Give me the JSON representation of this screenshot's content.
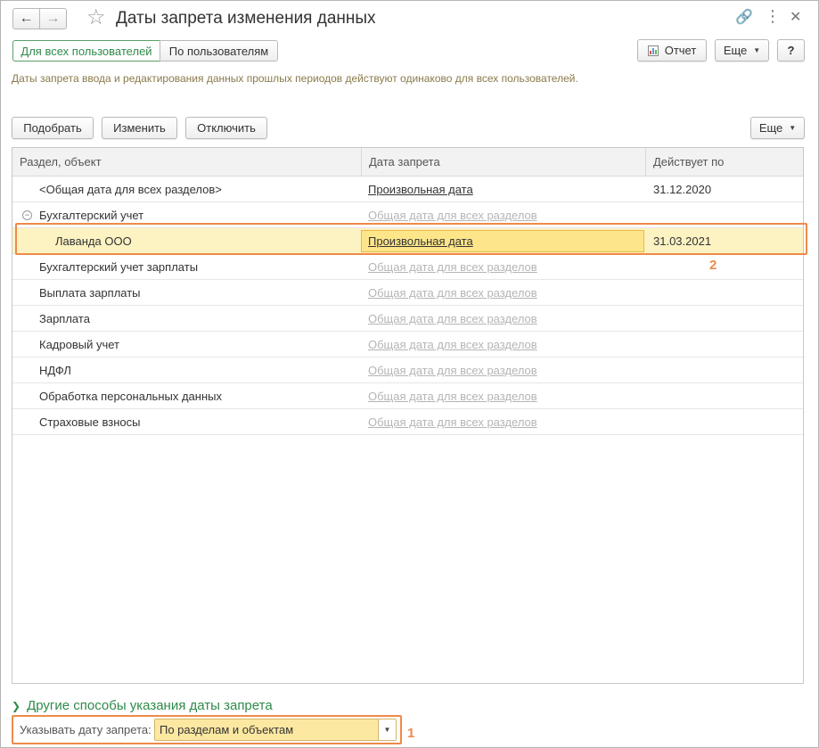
{
  "window": {
    "title": "Даты запрета изменения данных"
  },
  "toolbar_top": {
    "tab_all_users": "Для всех пользователей",
    "tab_by_users": "По пользователям",
    "report_label": "Отчет",
    "more_label": "Еще",
    "help_label": "?"
  },
  "info_text": "Даты запрета ввода и редактирования данных прошлых периодов действуют одинаково для всех пользователей.",
  "table_toolbar": {
    "pick_label": "Подобрать",
    "edit_label": "Изменить",
    "disable_label": "Отключить",
    "more_label": "Еще"
  },
  "table": {
    "columns": [
      "Раздел, объект",
      "Дата запрета",
      "Действует по"
    ],
    "rows": [
      {
        "name": "<Общая дата для всех разделов>",
        "date": "Произвольная дата",
        "until": "31.12.2020"
      },
      {
        "name": "Бухгалтерский учет",
        "date": "Общая дата для всех разделов",
        "until": ""
      },
      {
        "name": "Лаванда ООО",
        "date": "Произвольная дата",
        "until": "31.03.2021"
      },
      {
        "name": "Бухгалтерский учет зарплаты",
        "date": "Общая дата для всех разделов",
        "until": ""
      },
      {
        "name": "Выплата зарплаты",
        "date": "Общая дата для всех разделов",
        "until": ""
      },
      {
        "name": "Зарплата",
        "date": "Общая дата для всех разделов",
        "until": ""
      },
      {
        "name": "Кадровый учет",
        "date": "Общая дата для всех разделов",
        "until": ""
      },
      {
        "name": "НДФЛ",
        "date": "Общая дата для всех разделов",
        "until": ""
      },
      {
        "name": "Обработка персональных данных",
        "date": "Общая дата для всех разделов",
        "until": ""
      },
      {
        "name": "Страховые взносы",
        "date": "Общая дата для всех разделов",
        "until": ""
      }
    ]
  },
  "bottom": {
    "other_methods": "Другие способы указания даты запрета",
    "field_label": "Указывать дату запрета:",
    "field_value": "По разделам и объектам"
  },
  "annotations": {
    "marker_1": "1",
    "marker_2": "2"
  },
  "colors": {
    "accent_green": "#2f8a4a",
    "annotation_orange": "#ee8a4a",
    "selection_yellow": "#fde68a"
  }
}
